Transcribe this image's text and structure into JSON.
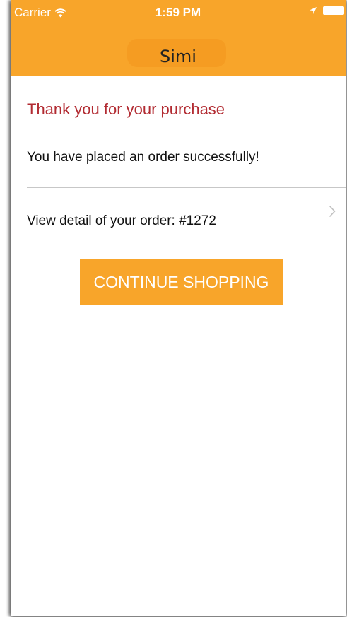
{
  "status_bar": {
    "carrier": "Carrier",
    "time": "1:59 PM",
    "icons": [
      "wifi-icon",
      "location-icon",
      "battery-icon"
    ]
  },
  "nav": {
    "title": "Simi"
  },
  "main": {
    "title": "Thank you for your purchase",
    "message": "You have placed an order successfully!",
    "order_link": "View detail of your order: #1272",
    "continue_label": "CONTINUE SHOPPING"
  },
  "colors": {
    "accent": "#f8a52a",
    "title_red": "#b22b32",
    "text": "#111111",
    "divider": "#c7c7c7"
  }
}
